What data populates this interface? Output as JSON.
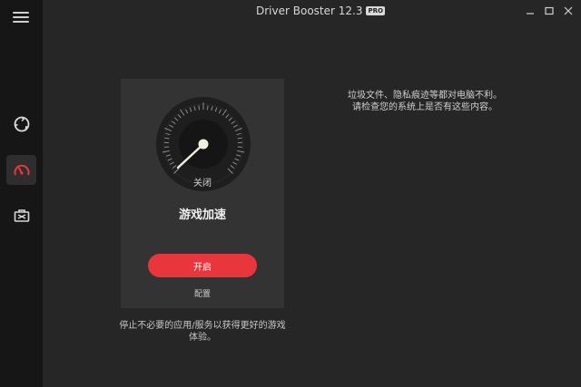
{
  "window": {
    "title": "Driver Booster 12.3",
    "badge": "PRO"
  },
  "sidebar": {
    "items": [
      {
        "name": "scan",
        "icon": "circle-arrows-icon",
        "active": false
      },
      {
        "name": "boost",
        "icon": "speedometer-icon",
        "active": true
      },
      {
        "name": "toolbox",
        "icon": "toolbox-icon",
        "active": false
      }
    ]
  },
  "game_boost": {
    "status": "关闭",
    "title": "游戏加速",
    "start_label": "开启",
    "config_label": "配置",
    "description": "停止不必要的应用/服务以获得更好的游戏体验。"
  },
  "info": {
    "text": "垃圾文件、隐私痕迹等都对电脑不利。 请检查您的系统上是否有这些内容。"
  },
  "colors": {
    "accent": "#e8363c",
    "sidebar_bg": "#161616",
    "main_bg": "#262626",
    "card_bg": "#333333",
    "active_icon": "#e8363c"
  }
}
